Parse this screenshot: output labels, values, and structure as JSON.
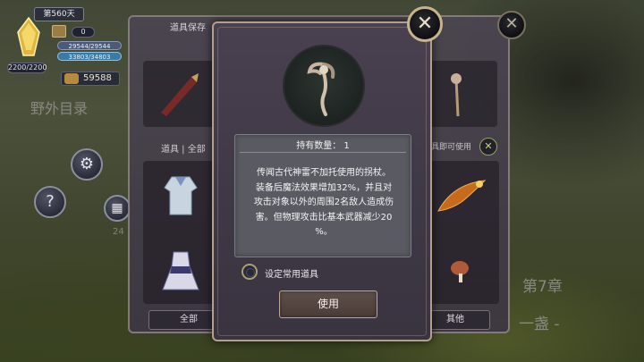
{
  "background": {
    "area_title": "野外目录",
    "chapter_label": "第7章",
    "chapter_sub": "一盏 -",
    "side_number": "24"
  },
  "hud": {
    "day": "第560天",
    "hp_text": "2200/2200",
    "counter": "0",
    "bar1": "29544/29544",
    "bar2": "33803/34803",
    "gold": "59588"
  },
  "back_panel": {
    "title": "道具保存",
    "filter_tabs": "道具 | 全部",
    "equip_hint": "具即可使用",
    "all_button": "全部",
    "other_button": "其他"
  },
  "detail": {
    "quantity_label": "持有数量：",
    "quantity_value": "1",
    "description": "传闻古代神雷不加托使用的拐杖。\n装备后魔法效果增加32%，并且对\n攻击对象以外的周围2名敌人造成伤\n害。但物理攻击比基本武器减少20\n%。",
    "favorite_label": "设定常用道具",
    "use_button": "使用"
  },
  "icons": {
    "close_front": "close-icon",
    "close_back": "close-icon",
    "gear": "gear-icon",
    "help": "help-icon",
    "calculator": "calculator-icon",
    "crystal": "crystal-icon",
    "gold": "gold-coin-icon",
    "staff": "staff-item-icon"
  },
  "colors": {
    "panel_border": "#b49e8c",
    "desc_box": "#5a5a62",
    "use_button": "#4a3c37"
  }
}
